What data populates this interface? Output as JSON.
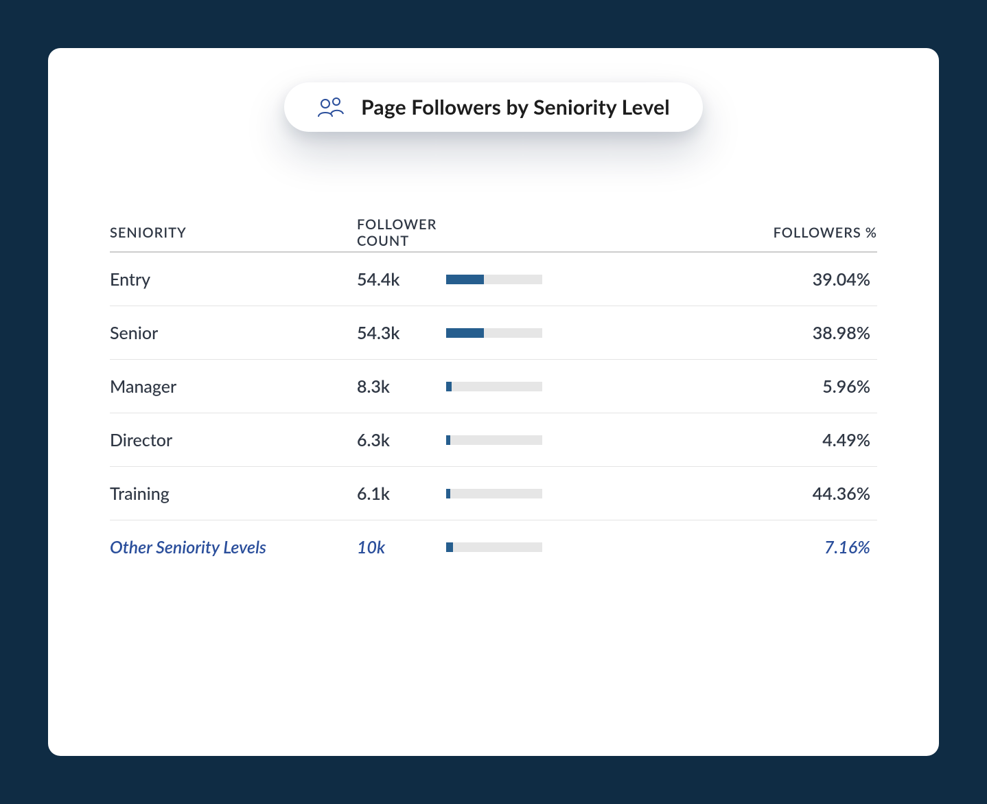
{
  "card": {
    "title": "Page Followers by Seniority Level",
    "columns": {
      "seniority": "SENIORITY",
      "follower_count": "FOLLOWER COUNT",
      "followers_pct": "FOLLOWERS %"
    },
    "rows": [
      {
        "name": "Entry",
        "count": "54.4k",
        "bar_pct": 39.04,
        "pct": "39.04%",
        "other": false
      },
      {
        "name": "Senior",
        "count": "54.3k",
        "bar_pct": 38.98,
        "pct": "38.98%",
        "other": false
      },
      {
        "name": "Manager",
        "count": "8.3k",
        "bar_pct": 5.96,
        "pct": "5.96%",
        "other": false
      },
      {
        "name": "Director",
        "count": "6.3k",
        "bar_pct": 4.49,
        "pct": "4.49%",
        "other": false
      },
      {
        "name": "Training",
        "count": "6.1k",
        "bar_pct": 4.36,
        "pct": "44.36%",
        "other": false
      },
      {
        "name": "Other Seniority Levels",
        "count": "10k",
        "bar_pct": 7.16,
        "pct": "7.16%",
        "other": true
      }
    ]
  },
  "chart_data": {
    "type": "bar",
    "title": "Page Followers by Seniority Level",
    "categories": [
      "Entry",
      "Senior",
      "Manager",
      "Director",
      "Training",
      "Other Seniority Levels"
    ],
    "series": [
      {
        "name": "Follower Count",
        "values": [
          "54.4k",
          "54.3k",
          "8.3k",
          "6.3k",
          "6.1k",
          "10k"
        ]
      },
      {
        "name": "Followers %",
        "values": [
          39.04,
          38.98,
          5.96,
          4.49,
          44.36,
          7.16
        ]
      }
    ],
    "xlabel": "",
    "ylabel": ""
  }
}
